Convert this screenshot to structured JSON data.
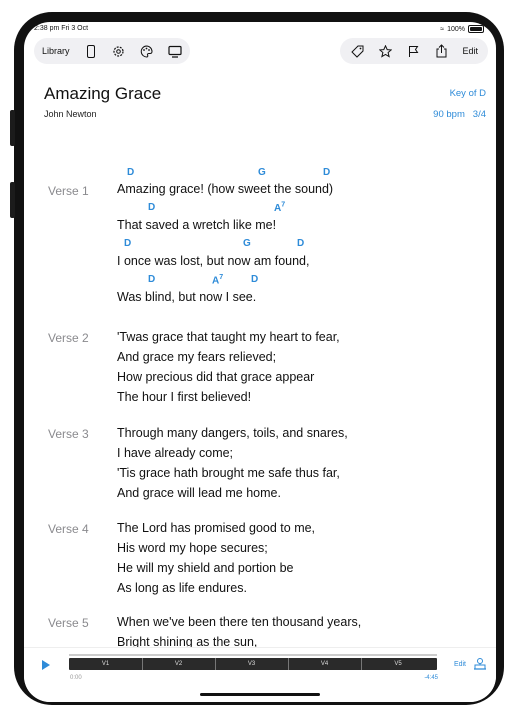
{
  "status": {
    "time": "2:38 pm  Fri 3 Oct",
    "battery": "100%"
  },
  "toolbar": {
    "library_label": "Library",
    "edit_label": "Edit"
  },
  "song": {
    "title": "Amazing Grace",
    "author": "John Newton",
    "key": "Key of D",
    "tempo": "90 bpm",
    "time_signature": "3/4"
  },
  "verses": [
    {
      "label": "Verse 1",
      "lines": [
        "Amazing grace! (how sweet the sound)",
        "That saved a wretch like me!",
        "I once was lost, but now am found,",
        "Was blind, but now I see."
      ],
      "chords": [
        [
          "D",
          "G",
          "D"
        ],
        [
          "D",
          "A7"
        ],
        [
          "D",
          "G",
          "D"
        ],
        [
          "D",
          "A7",
          "D"
        ]
      ]
    },
    {
      "label": "Verse 2",
      "lines": [
        "'Twas grace that taught my heart to fear,",
        "And grace my fears relieved;",
        "How precious did that grace appear",
        "The hour I first believed!"
      ]
    },
    {
      "label": "Verse 3",
      "lines": [
        "Through many dangers, toils, and snares,",
        "I have already come;",
        "'Tis grace hath brought me safe thus far,",
        "And grace will lead me home."
      ]
    },
    {
      "label": "Verse 4",
      "lines": [
        "The Lord has promised good to me,",
        "His word my hope secures;",
        "He will my shield and portion be",
        "As long as life endures."
      ]
    },
    {
      "label": "Verse 5",
      "lines": [
        "When we've been there ten thousand years,",
        "Bright shining as the sun,"
      ]
    }
  ],
  "player": {
    "segments": [
      "V1",
      "V2",
      "V3",
      "V4",
      "V5"
    ],
    "time_elapsed": "0:00",
    "time_remaining": "-4:45",
    "edit_label": "Edit"
  },
  "colors": {
    "accent": "#2e8bd8",
    "verse_label": "#8a8a8e"
  }
}
